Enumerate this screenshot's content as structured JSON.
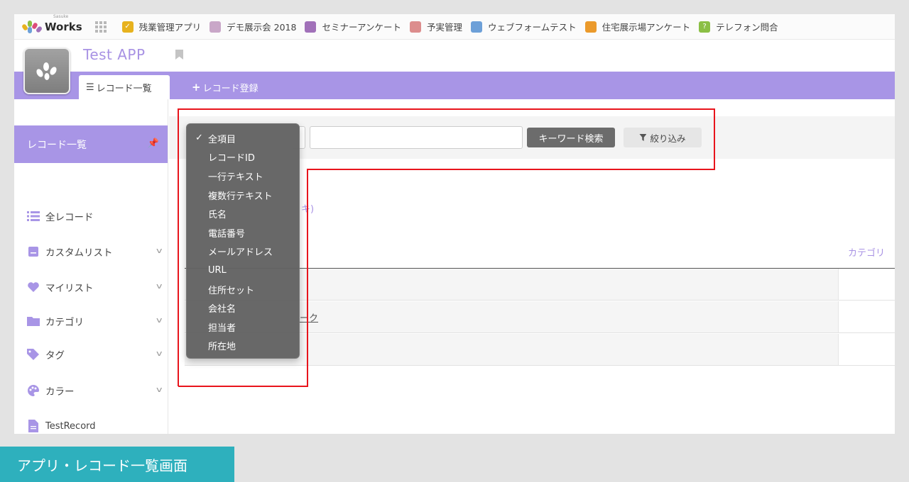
{
  "topbar": {
    "logo_sub": "Sasuke",
    "logo_text": "Works",
    "bookmarks": [
      {
        "label": "残業管理アプリ",
        "color": "#e7b21e",
        "glyph": "✓"
      },
      {
        "label": "デモ展示会 2018",
        "color": "#c9a7c8",
        "glyph": ""
      },
      {
        "label": "セミナーアンケート",
        "color": "#a171b9",
        "glyph": ""
      },
      {
        "label": "予実管理",
        "color": "#dc8d8d",
        "glyph": ""
      },
      {
        "label": "ウェブフォームテスト",
        "color": "#6da0d8",
        "glyph": ""
      },
      {
        "label": "住宅展示場アンケート",
        "color": "#eb9a2b",
        "glyph": ""
      },
      {
        "label": "テレフォン問合",
        "color": "#8bbf45",
        "glyph": "?"
      }
    ]
  },
  "app": {
    "title": "Test APP",
    "tabs": {
      "list": "レコード一覧",
      "add": "レコード登録"
    }
  },
  "sidebar": {
    "header": "レコード一覧",
    "items": [
      {
        "label": "全レコード",
        "icon": "list-icon",
        "color": "#a895e6",
        "chevron": false
      },
      {
        "label": "カスタムリスト",
        "icon": "custom-list-icon",
        "color": "#a895e6",
        "chevron": true
      },
      {
        "label": "マイリスト",
        "icon": "heart-icon",
        "color": "#a895e6",
        "chevron": true
      },
      {
        "label": "カテゴリ",
        "icon": "folder-icon",
        "color": "#a895e6",
        "chevron": true
      },
      {
        "label": "タグ",
        "icon": "tag-icon",
        "color": "#a895e6",
        "chevron": true
      },
      {
        "label": "カラー",
        "icon": "palette-icon",
        "color": "#a895e6",
        "chevron": true
      },
      {
        "label": "TestRecord",
        "icon": "document-icon",
        "color": "#a895e6",
        "chevron": false
      }
    ]
  },
  "search": {
    "keyword_button": "キーワード検索",
    "filter_button": "絞り込み",
    "keyword_value": ""
  },
  "dropdown": {
    "selected": "全項目",
    "options": [
      "全項目",
      "レコードID",
      "一行テキスト",
      "複数行テキスト",
      "氏名",
      "電話番号",
      "メールアドレス",
      "URL",
      "住所セット",
      "会社名",
      "担当者",
      "所在地"
    ]
  },
  "table": {
    "column_header": "カテゴリ",
    "partial_link": "キ)",
    "partial_cell": "ーク"
  },
  "caption": "アプリ・レコード一覧画面",
  "colors": {
    "accent": "#a895e6",
    "highlight": "#e8141c",
    "caption_bg": "#2eb0bd"
  }
}
